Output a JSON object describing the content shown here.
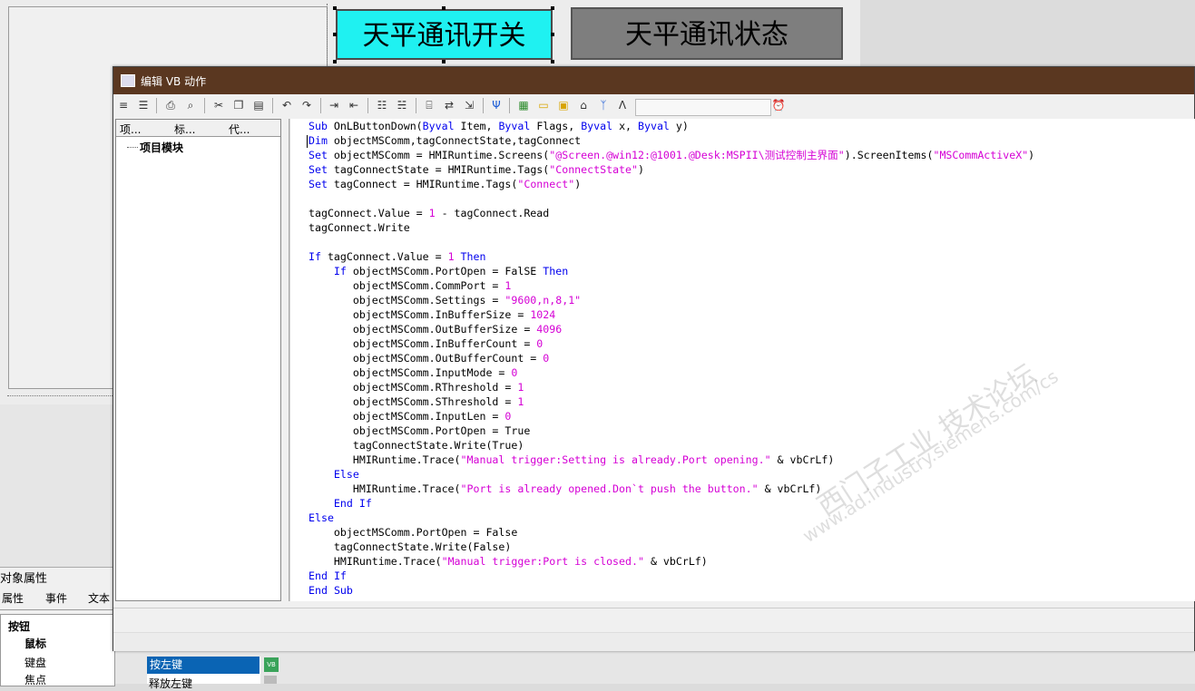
{
  "canvas": {
    "button_switch": "天平通讯开关",
    "button_status": "天平通讯状态"
  },
  "properties_panel": {
    "title": "对象属性",
    "tabs": [
      "属性",
      "事件",
      "文本"
    ],
    "tree": [
      "按钮",
      "鼠标",
      "键盘",
      "焦点"
    ],
    "events": [
      "按左键",
      "释放左键"
    ]
  },
  "editor": {
    "title": "编辑 VB 动作",
    "left_tabs": [
      "项...",
      "标...",
      "代..."
    ],
    "tree_root": "项目模块",
    "search_placeholder": ""
  },
  "code_lines": [
    "Sub OnLButtonDown(Byval Item, Byval Flags, Byval x, Byval y)",
    "Dim objectMSComm,tagConnectState,tagConnect",
    "Set objectMSComm = HMIRuntime.Screens(\"@Screen.@win12:@1001.@Desk:MSPII\\测试控制主界面\").ScreenItems(\"MSCommActiveX\")",
    "Set tagConnectState = HMIRuntime.Tags(\"ConnectState\")",
    "Set tagConnect = HMIRuntime.Tags(\"Connect\")",
    "",
    "tagConnect.Value = 1 - tagConnect.Read",
    "tagConnect.Write",
    "",
    "If tagConnect.Value = 1 Then",
    "    If objectMSComm.PortOpen = FalSE Then",
    "       objectMSComm.CommPort = 1",
    "       objectMSComm.Settings = \"9600,n,8,1\"",
    "       objectMSComm.InBufferSize = 1024",
    "       objectMSComm.OutBufferSize = 4096",
    "       objectMSComm.InBufferCount = 0",
    "       objectMSComm.OutBufferCount = 0",
    "       objectMSComm.InputMode = 0",
    "       objectMSComm.RThreshold = 1",
    "       objectMSComm.SThreshold = 1",
    "       objectMSComm.InputLen = 0",
    "       objectMSComm.PortOpen = True",
    "       tagConnectState.Write(True)",
    "       HMIRuntime.Trace(\"Manual trigger:Setting is already.Port opening.\" & vbCrLf)",
    "    Else",
    "       HMIRuntime.Trace(\"Port is already opened.Don`t push the button.\" & vbCrLf)",
    "    End If",
    "Else",
    "    objectMSComm.PortOpen = False",
    "    tagConnectState.Write(False)",
    "    HMIRuntime.Trace(\"Manual trigger:Port is closed.\" & vbCrLf)",
    "End If",
    "End Sub"
  ],
  "watermark": {
    "line1": "西门子工业  技术论坛",
    "line2": "www.ad.industry.siemens.com/cs"
  }
}
